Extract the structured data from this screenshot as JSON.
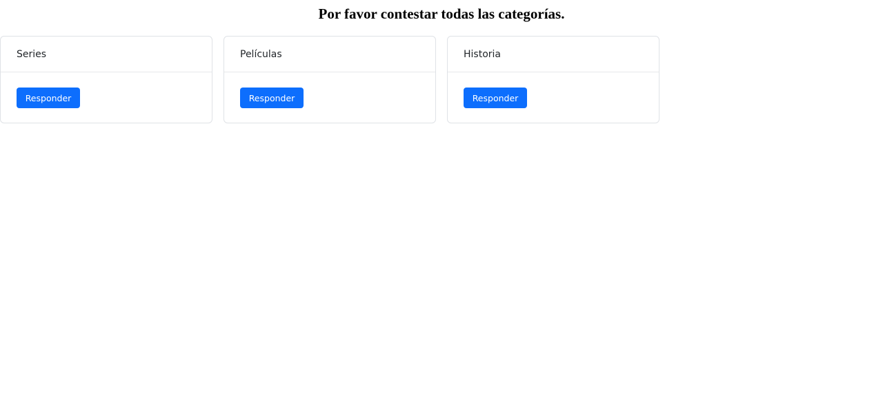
{
  "page": {
    "title": "Por favor contestar todas las categorías."
  },
  "categories": [
    {
      "name": "Series",
      "button_label": "Responder"
    },
    {
      "name": "Películas",
      "button_label": "Responder"
    },
    {
      "name": "Historia",
      "button_label": "Responder"
    }
  ],
  "colors": {
    "button_bg": "#0d6efd",
    "button_text": "#ffffff",
    "card_border": "#dfe2e6"
  }
}
